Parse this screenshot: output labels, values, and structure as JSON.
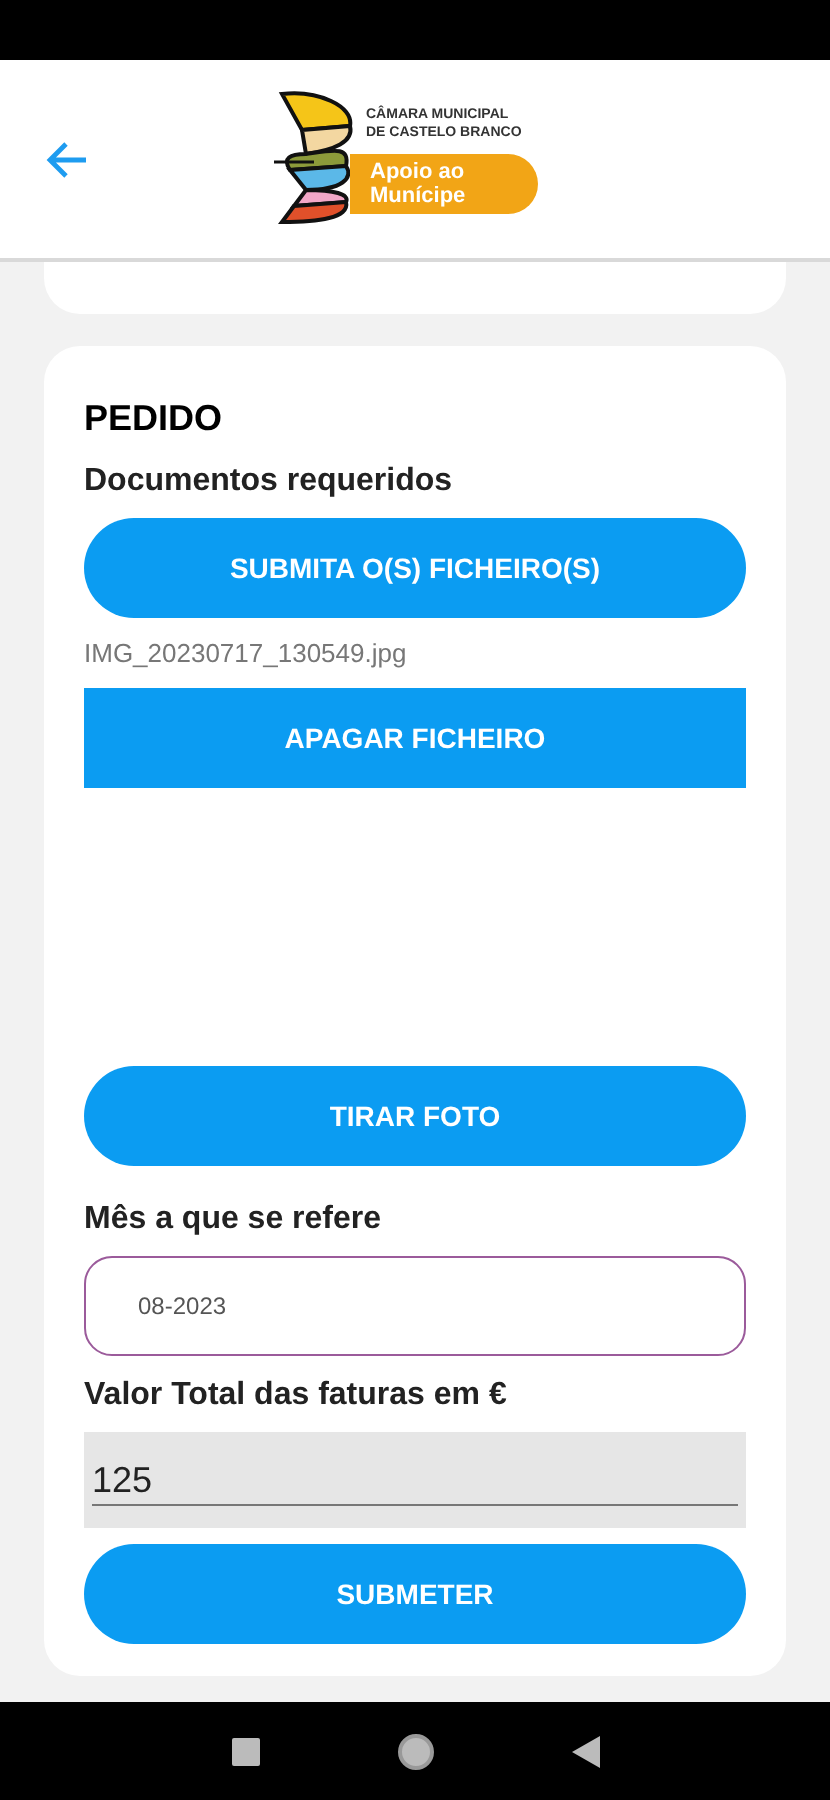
{
  "header": {
    "logo_lines": [
      "CÂMARA MUNICIPAL",
      "DE CASTELO BRANCO"
    ],
    "logo_badge": "Apoio ao Munícipe"
  },
  "form": {
    "title": "PEDIDO",
    "documents_label": "Documentos requeridos",
    "upload_button": "SUBMITA O(S) FICHEIRO(S)",
    "file_name": "IMG_20230717_130549.jpg",
    "delete_button": "APAGAR FICHEIRO",
    "photo_button": "TIRAR FOTO",
    "month_label": "Mês a que se refere",
    "month_value": "08-2023",
    "total_label": "Valor Total das faturas em €",
    "total_value": "125",
    "submit_button": "SUBMETER"
  }
}
